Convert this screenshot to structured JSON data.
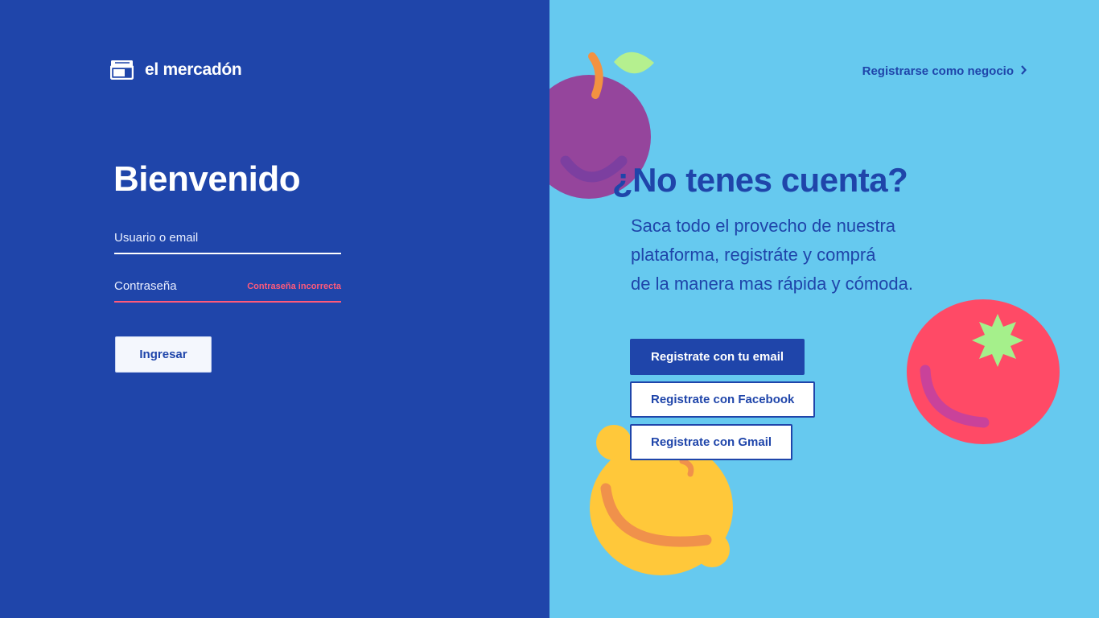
{
  "brand": {
    "name": "el mercadón",
    "icon": "storefront-icon"
  },
  "login": {
    "title": "Bienvenido",
    "user_placeholder": "Usuario o email",
    "password_placeholder": "Contraseña",
    "password_error": "Contraseña incorrecta",
    "submit_label": "Ingresar"
  },
  "signup": {
    "business_link": "Registrarse como negocio",
    "title": "¿No tenes cuenta?",
    "description": [
      "Saca todo el provecho de nuestra",
      "plataforma, registráte y comprá",
      "de la manera mas rápida y cómoda."
    ],
    "email_button": "Registrate con tu email",
    "facebook_button": "Registrate con Facebook",
    "gmail_button": "Registrate con Gmail"
  },
  "colors": {
    "left_bg": "#1f45aa",
    "right_bg": "#66c9ef",
    "error": "#ff5a7a"
  },
  "decorations": [
    "plum-illustration",
    "tomato-illustration",
    "lemon-illustration"
  ]
}
